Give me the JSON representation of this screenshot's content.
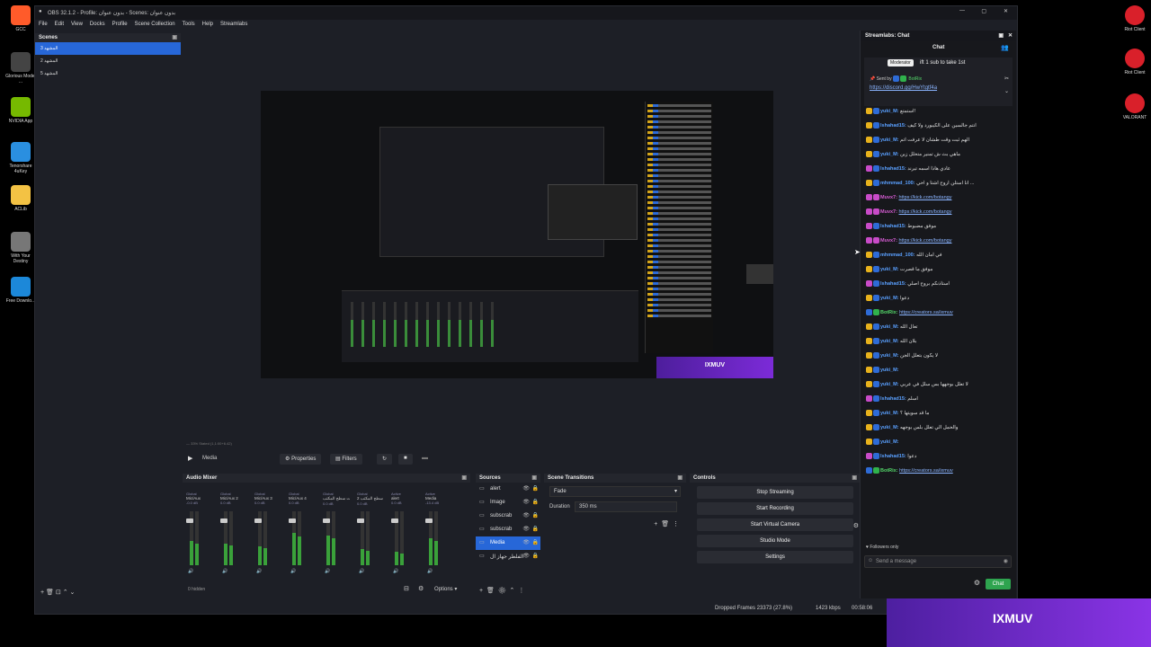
{
  "desktop_icons": [
    {
      "label": "GCC",
      "icon": "gcc-icon",
      "color": "#ff5b2a"
    },
    {
      "label": "Glorious Model ...",
      "icon": "glorious-icon",
      "color": "#444444"
    },
    {
      "label": "NVIDIA App",
      "icon": "nvidia-icon",
      "color": "#76b900"
    },
    {
      "label": "Tenorshare 4uKey",
      "icon": "tenorshare-icon",
      "color": "#2a8fe0"
    },
    {
      "label": "ACLib",
      "icon": "folder-icon",
      "color": "#f3c244"
    },
    {
      "label": "With Your Destiny",
      "icon": "game-icon",
      "color": "#777777"
    },
    {
      "label": "Free Downlo...",
      "icon": "download-icon",
      "color": "#1c88d9"
    }
  ],
  "right_icons": [
    {
      "label": "Riot Client",
      "icon": "riot-icon"
    },
    {
      "label": "Riot Client",
      "icon": "riot-icon"
    },
    {
      "label": "VALORANT",
      "icon": "valorant-icon"
    }
  ],
  "window": {
    "title": "OBS 32.1.2 - Profile: بدون عنوان - Scenes: بدون عنوان",
    "controls": [
      "—",
      "▢",
      "✕"
    ]
  },
  "menu": [
    "File",
    "Edit",
    "View",
    "Docks",
    "Profile",
    "Scene Collection",
    "Tools",
    "Help",
    "Streamlabs"
  ],
  "scenes": {
    "title": "Scenes",
    "items": [
      "3 المشهد",
      "2 المشهد",
      "5 المشهد"
    ],
    "selected_index": 0
  },
  "preview": {
    "banner_text": "IXMUV",
    "status_left": "— 33% Stated (1,1:00+6.42)",
    "status_right": "-:-- / -:--"
  },
  "media_bar": {
    "source_label": "Media",
    "properties": "Properties",
    "filters": "Filters"
  },
  "audio_mixer": {
    "title": "Audio Mixer",
    "channels": [
      {
        "name": "Mic/Aux",
        "tag": "Global",
        "level": 0.45,
        "db": "-0.0 dB"
      },
      {
        "name": "Mic/Aux 2",
        "tag": "Global",
        "level": 0.4,
        "db": "0.0 dB"
      },
      {
        "name": "Mic/Aux 3",
        "tag": "Global",
        "level": 0.35,
        "db": "0.0 dB"
      },
      {
        "name": "Mic/Aux 4",
        "tag": "Global",
        "level": 0.6,
        "db": "0.0 dB"
      },
      {
        "name": "صوت سطح المكتب",
        "tag": "Global",
        "level": 0.55,
        "db": "0.0 dB"
      },
      {
        "name": "2 صوت سطح المكتب",
        "tag": "Global",
        "level": 0.3,
        "db": "0.0 dB"
      },
      {
        "name": "alert",
        "tag": "Active",
        "level": 0.25,
        "db": "0.0 dB"
      },
      {
        "name": "Media",
        "tag": "Active",
        "level": 0.5,
        "db": "-13.4 dB"
      }
    ],
    "hidden_count": "0 hidden",
    "options": "Options"
  },
  "sources": {
    "title": "Sources",
    "items": [
      "alert",
      "Image",
      "subscrab",
      "subscrab",
      "Media",
      "الفلطر جهاز ال"
    ],
    "selected_index": 4
  },
  "transitions": {
    "title": "Scene Transitions",
    "type": "Fade",
    "duration_label": "Duration",
    "duration_value": "350 ms"
  },
  "controls": {
    "title": "Controls",
    "buttons": [
      "Stop Streaming",
      "Start Recording",
      "Start Virtual Camera",
      "Studio Mode",
      "Settings"
    ]
  },
  "statusbar": {
    "dropped": "Dropped Frames 23373 (27.8%)",
    "bitrate": "1423 kbps",
    "time": "00:58:06"
  },
  "chat": {
    "window_title": "Streamlabs: Chat",
    "tab": "Chat",
    "moderator_tooltip": "Moderator",
    "pinned_title": "ift 1 sub to take 1st",
    "pinned_by": "Sent by",
    "pinned_user": "BotRix",
    "pinned_link": "https://discord.gg/HwYtgtf4a",
    "messages": [
      {
        "user": "yuki_M:",
        "text": "استمتع!",
        "color": "blue",
        "badges": [
          "y",
          "b"
        ]
      },
      {
        "user": "lshahad15:",
        "text": "انتم جالسين على الكيبورد ولا كيف",
        "color": "blue",
        "badges": [
          "y",
          "b"
        ]
      },
      {
        "user": "yuki_M:",
        "text": "الهم ثبت وقت طشان لا عرفت اتم",
        "color": "blue",
        "badges": [
          "y",
          "b"
        ]
      },
      {
        "user": "yuki_M:",
        "text": "ماهي بث ش تمنير متحلل زين",
        "color": "blue",
        "badges": [
          "y",
          "b"
        ]
      },
      {
        "user": "lshahad15:",
        "text": "عادي هاذا اسمه تيرند",
        "color": "blue",
        "badges": [
          "p",
          "b"
        ]
      },
      {
        "user": "mhmmad_100:",
        "text": "انا استلن اروح اشتا و احي ...",
        "color": "blue",
        "badges": [
          "y",
          "b"
        ]
      },
      {
        "user": "Muvx7:",
        "text": "https://kick.com/botangy",
        "color": "pink",
        "badges": [
          "p",
          "p"
        ],
        "link": true
      },
      {
        "user": "Muvx7:",
        "text": "https://kick.com/botangy",
        "color": "pink",
        "badges": [
          "p",
          "p"
        ],
        "link": true
      },
      {
        "user": "lshahad15:",
        "text": "موفق مضبوط",
        "color": "blue",
        "badges": [
          "p",
          "b"
        ]
      },
      {
        "user": "Muvx7:",
        "text": "https://kick.com/botangy",
        "color": "pink",
        "badges": [
          "p",
          "p"
        ],
        "link": true
      },
      {
        "user": "mhmmad_100:",
        "text": "في امان الله",
        "color": "blue",
        "badges": [
          "y",
          "b"
        ]
      },
      {
        "user": "yuki_M:",
        "text": "موفق ما قصرت",
        "color": "blue",
        "badges": [
          "y",
          "b"
        ]
      },
      {
        "user": "lshahad15:",
        "text": "استاذنكم بروح اصلي",
        "color": "blue",
        "badges": [
          "p",
          "b"
        ]
      },
      {
        "user": "yuki_M:",
        "text": "دعوا",
        "color": "blue",
        "badges": [
          "y",
          "b"
        ]
      },
      {
        "user": "BotRix:",
        "text": "https://creators.sa/ixmuv",
        "color": "green",
        "badges": [
          "b",
          "g"
        ],
        "link": true
      },
      {
        "user": "yuki_M:",
        "text": "تعال الله",
        "color": "blue",
        "badges": [
          "y",
          "b"
        ]
      },
      {
        "user": "yuki_M:",
        "text": "بلان الله",
        "color": "blue",
        "badges": [
          "y",
          "b"
        ]
      },
      {
        "user": "yuki_M:",
        "text": "لا يكون بتعلل الجن",
        "color": "blue",
        "badges": [
          "y",
          "b"
        ]
      },
      {
        "user": "yuki_M:",
        "text": "",
        "color": "blue",
        "badges": [
          "y",
          "b"
        ]
      },
      {
        "user": "yuki_M:",
        "text": "لا تعلل بوجهها بس سلل في عربي",
        "color": "blue",
        "badges": [
          "y",
          "b"
        ]
      },
      {
        "user": "lshahad15:",
        "text": "اسلم",
        "color": "blue",
        "badges": [
          "p",
          "b"
        ]
      },
      {
        "user": "yuki_M:",
        "text": "ما قد سويتها ؟",
        "color": "blue",
        "badges": [
          "y",
          "b"
        ]
      },
      {
        "user": "yuki_M:",
        "text": "والحمل الي تعلل بلس بوجهه",
        "color": "blue",
        "badges": [
          "y",
          "b"
        ]
      },
      {
        "user": "yuki_M:",
        "text": "",
        "color": "blue",
        "badges": [
          "y",
          "b"
        ]
      },
      {
        "user": "lshahad15:",
        "text": "دعوا",
        "color": "blue",
        "badges": [
          "p",
          "b"
        ]
      },
      {
        "user": "BotRix:",
        "text": "https://creators.sa/ixmuv",
        "color": "green",
        "badges": [
          "b",
          "g"
        ],
        "link": true
      }
    ],
    "followers_only": "Followers only",
    "input_placeholder": "Send a message",
    "send_label": "Chat"
  },
  "stream_banner": {
    "text": "IXMUV"
  }
}
